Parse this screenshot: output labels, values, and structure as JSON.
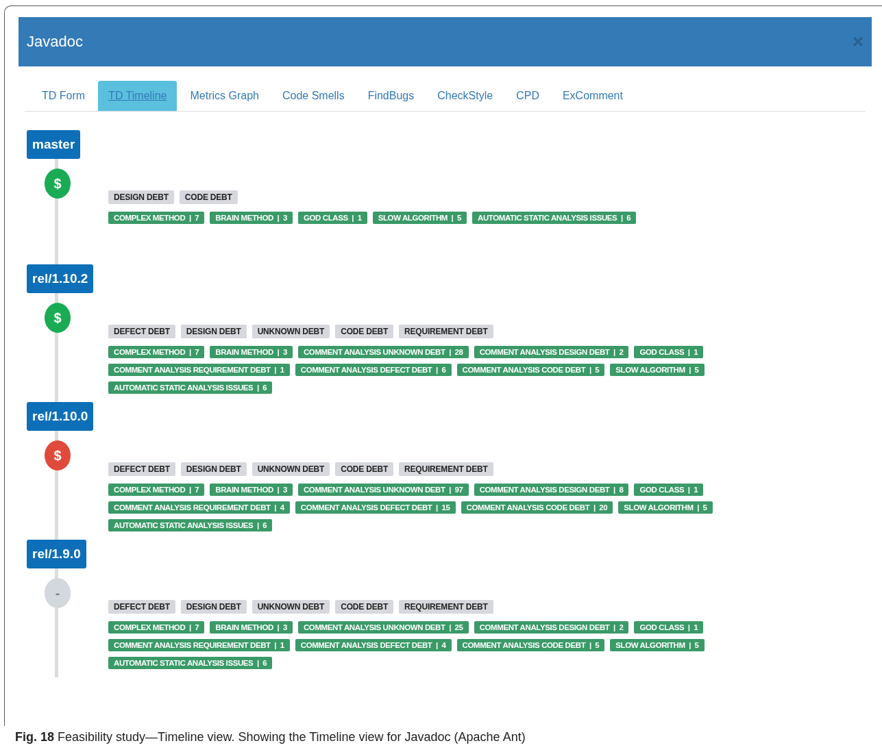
{
  "window": {
    "title": "Javadoc",
    "close": "×"
  },
  "tabs": [
    {
      "label": "TD Form",
      "selected": false
    },
    {
      "label": "TD Timeline",
      "selected": true
    },
    {
      "label": "Metrics Graph",
      "selected": false
    },
    {
      "label": "Code Smells",
      "selected": false
    },
    {
      "label": "FindBugs",
      "selected": false
    },
    {
      "label": "CheckStyle",
      "selected": false
    },
    {
      "label": "CPD",
      "selected": false
    },
    {
      "label": "ExComment",
      "selected": false
    }
  ],
  "timeline": [
    {
      "branch": "master",
      "kind": "ok",
      "symbol": "$",
      "debt_types": [
        "DESIGN DEBT",
        "CODE DEBT"
      ],
      "metric_rows": [
        [
          {
            "text": "COMPLEX METHOD  |  7"
          },
          {
            "text": "BRAIN METHOD  |  3"
          },
          {
            "text": "GOD CLASS  |  1"
          },
          {
            "text": "SLOW ALGORITHM  |  5"
          },
          {
            "text": "AUTOMATIC STATIC ANALYSIS ISSUES  |  6"
          }
        ]
      ]
    },
    {
      "branch": "rel/1.10.2",
      "kind": "ok",
      "symbol": "$",
      "debt_types": [
        "DEFECT DEBT",
        "DESIGN DEBT",
        "UNKNOWN DEBT",
        "CODE DEBT",
        "REQUIREMENT DEBT"
      ],
      "metric_rows": [
        [
          {
            "text": "COMPLEX METHOD  |  7"
          },
          {
            "text": "BRAIN METHOD  |  3"
          },
          {
            "text": "COMMENT ANALYSIS UNKNOWN DEBT  |  28"
          },
          {
            "text": "COMMENT ANALYSIS DESIGN DEBT  |  2"
          },
          {
            "text": "GOD CLASS  |  1"
          }
        ],
        [
          {
            "text": "COMMENT ANALYSIS REQUIREMENT DEBT  |  1"
          },
          {
            "text": "COMMENT ANALYSIS DEFECT DEBT  |  6"
          },
          {
            "text": "COMMENT ANALYSIS CODE DEBT  |  5"
          },
          {
            "text": "SLOW ALGORITHM  |  5"
          }
        ],
        [
          {
            "text": "AUTOMATIC STATIC ANALYSIS ISSUES  |  6"
          }
        ]
      ]
    },
    {
      "branch": "rel/1.10.0",
      "kind": "bad",
      "symbol": "$",
      "debt_types": [
        "DEFECT DEBT",
        "DESIGN DEBT",
        "UNKNOWN DEBT",
        "CODE DEBT",
        "REQUIREMENT DEBT"
      ],
      "metric_rows": [
        [
          {
            "text": "COMPLEX METHOD  |  7"
          },
          {
            "text": "BRAIN METHOD  |  3"
          },
          {
            "text": "COMMENT ANALYSIS UNKNOWN DEBT  |  97"
          },
          {
            "text": "COMMENT ANALYSIS DESIGN DEBT  |  8"
          },
          {
            "text": "GOD CLASS  |  1"
          }
        ],
        [
          {
            "text": "COMMENT ANALYSIS REQUIREMENT DEBT  |  4"
          },
          {
            "text": "COMMENT ANALYSIS DEFECT DEBT  |  15"
          },
          {
            "text": "COMMENT ANALYSIS CODE DEBT  |  20"
          },
          {
            "text": "SLOW ALGORITHM  |  5"
          }
        ],
        [
          {
            "text": "AUTOMATIC STATIC ANALYSIS ISSUES  |  6"
          }
        ]
      ]
    },
    {
      "branch": "rel/1.9.0",
      "kind": "none",
      "symbol": "-",
      "debt_types": [
        "DEFECT DEBT",
        "DESIGN DEBT",
        "UNKNOWN DEBT",
        "CODE DEBT",
        "REQUIREMENT DEBT"
      ],
      "metric_rows": [
        [
          {
            "text": "COMPLEX METHOD  |  7"
          },
          {
            "text": "BRAIN METHOD  |  3"
          },
          {
            "text": "COMMENT ANALYSIS UNKNOWN DEBT  |  25"
          },
          {
            "text": "COMMENT ANALYSIS DESIGN DEBT  |  2"
          },
          {
            "text": "GOD CLASS  |  1"
          }
        ],
        [
          {
            "text": "COMMENT ANALYSIS REQUIREMENT DEBT  |  1"
          },
          {
            "text": "COMMENT ANALYSIS DEFECT DEBT  |  4"
          },
          {
            "text": "COMMENT ANALYSIS CODE DEBT  |  5"
          },
          {
            "text": "SLOW ALGORITHM  |  5"
          }
        ],
        [
          {
            "text": "AUTOMATIC STATIC ANALYSIS ISSUES  |  6"
          }
        ]
      ]
    }
  ],
  "caption": "**Fig. 18** Feasibility study—Timeline view. Showing the Timeline view for Javadoc (Apache Ant)"
}
